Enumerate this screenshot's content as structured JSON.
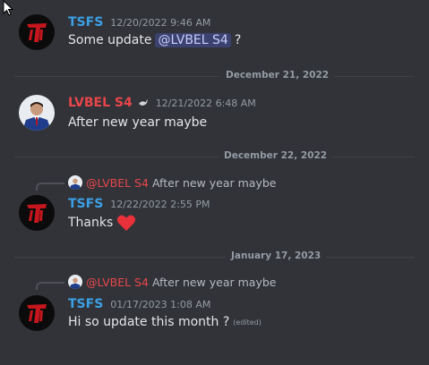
{
  "colors": {
    "background": "#313338",
    "tsfs_name": "#3ca0e6",
    "lvbel_name": "#e8464a",
    "mention_bg": "#3c4270",
    "mention_text": "#c9cdfb",
    "heart": "#e8313a"
  },
  "messages": [
    {
      "author": "TSFS",
      "timestamp": "12/20/2022 9:46 AM",
      "text_before": "Some update",
      "mention": "@LVBEL S4",
      "text_after": "?"
    },
    {
      "author": "LVBEL S4",
      "badge_icon": "sparrow-badge-icon",
      "timestamp": "12/21/2022 6:48 AM",
      "text": "After new year maybe"
    },
    {
      "reply_mention": "@LVBEL S4",
      "reply_text": "After new year maybe",
      "author": "TSFS",
      "timestamp": "12/22/2022 2:55 PM",
      "text": "Thanks",
      "emoji_icon": "red-heart-icon"
    },
    {
      "reply_mention": "@LVBEL S4",
      "reply_text": "After new year maybe",
      "author": "TSFS",
      "timestamp": "01/17/2023 1:08 AM",
      "text": "Hi so update this month ?",
      "edited": "(edited)"
    }
  ],
  "dividers": [
    "December 21, 2022",
    "December 22, 2022",
    "January 17, 2023"
  ]
}
